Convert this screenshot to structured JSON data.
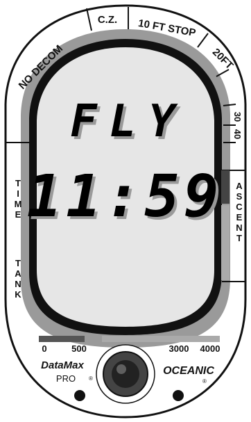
{
  "top_scale": {
    "cz": "C.Z.",
    "stop": "10 FT  STOP",
    "depth_20": "20FT",
    "depth_30": "30",
    "depth_40": "40",
    "no_decom": "NO DECOM"
  },
  "display": {
    "mode": "FLY",
    "time": "11:59"
  },
  "side_labels": {
    "left_time": [
      "T",
      "I",
      "M",
      "E"
    ],
    "left_tank": [
      "T",
      "A",
      "N",
      "K"
    ],
    "right_ascent": [
      "A",
      "S",
      "C",
      "E",
      "N",
      "T"
    ]
  },
  "bottom_scale": {
    "t0": "0",
    "t500": "500",
    "t3000": "3000",
    "t4000": "4000"
  },
  "branding": {
    "product": "DataMax",
    "product_sub": "PRO",
    "maker": "OCEANIC",
    "reg": "®"
  },
  "colors": {
    "lcd_bg": "#e6e6e6",
    "bezel_band": "#9a9a9a",
    "frame": "#111111"
  }
}
